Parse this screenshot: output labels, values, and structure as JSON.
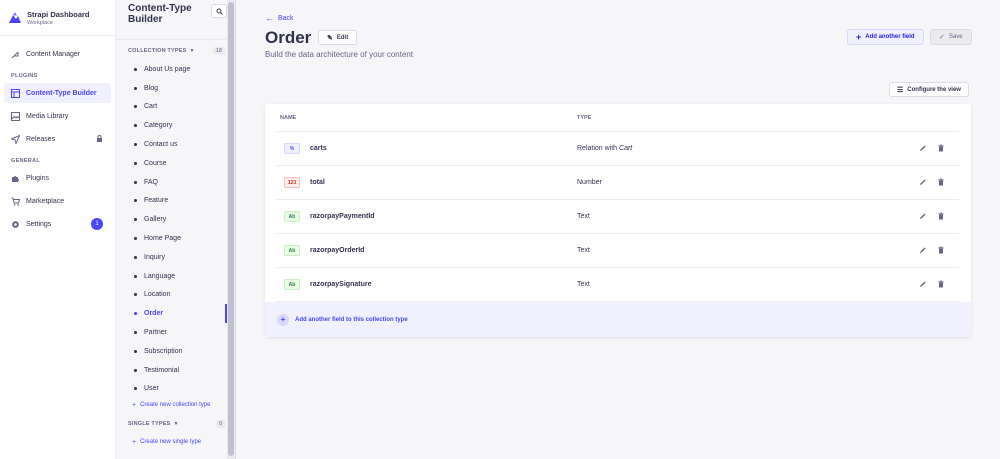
{
  "brand": {
    "name": "Strapi Dashboard",
    "sub": "Workplace"
  },
  "mainnav": {
    "content_manager": "Content Manager",
    "plugins_section": "PLUGINS",
    "ctb": "Content-Type Builder",
    "media_library": "Media Library",
    "releases": "Releases",
    "general_section": "GENERAL",
    "plugins": "Plugins",
    "marketplace": "Marketplace",
    "settings": "Settings",
    "settings_badge": "1"
  },
  "subnav": {
    "title_line1": "Content-Type",
    "title_line2": "Builder",
    "collection_label": "COLLECTION TYPES",
    "collection_count": "18",
    "collection_items": [
      "About Us page",
      "Blog",
      "Cart",
      "Category",
      "Contact us",
      "Course",
      "FAQ",
      "Feature",
      "Gallery",
      "Home Page",
      "Inquiry",
      "Language",
      "Location",
      "Order",
      "Partner",
      "Subscription",
      "Testimonial",
      "User"
    ],
    "create_collection": "Create new collection type",
    "single_label": "SINGLE TYPES",
    "single_count": "0",
    "create_single": "Create new single type"
  },
  "header": {
    "back": "Back",
    "title": "Order",
    "edit": "Edit",
    "subtitle": "Build the data architecture of your content",
    "add_field": "Add another field",
    "save": "Save",
    "configure": "Configure the view"
  },
  "table": {
    "col_name": "NAME",
    "col_type": "TYPE",
    "rows": [
      {
        "badge": "%",
        "name": "carts",
        "type_prefix": "Relation with ",
        "type_em": "Cart",
        "badge_bg": "#f0f0ff",
        "badge_fg": "#4945ff",
        "badge_border": "#d9d8ff"
      },
      {
        "badge": "123",
        "name": "total",
        "type_prefix": "Number",
        "type_em": "",
        "badge_bg": "#fcecea",
        "badge_fg": "#d02b20",
        "badge_border": "#f5c0b8"
      },
      {
        "badge": "Ab",
        "name": "razorpayPaymentId",
        "type_prefix": "Text",
        "type_em": "",
        "badge_bg": "#eafbe7",
        "badge_fg": "#328048",
        "badge_border": "#c6f0c2"
      },
      {
        "badge": "Ab",
        "name": "razorpayOrderId",
        "type_prefix": "Text",
        "type_em": "",
        "badge_bg": "#eafbe7",
        "badge_fg": "#328048",
        "badge_border": "#c6f0c2"
      },
      {
        "badge": "Ab",
        "name": "razorpaySignature",
        "type_prefix": "Text",
        "type_em": "",
        "badge_bg": "#eafbe7",
        "badge_fg": "#328048",
        "badge_border": "#c6f0c2"
      }
    ],
    "add_row": "Add another field to this collection type"
  },
  "icons": {
    "search": "search-icon",
    "pencil": "pencil-icon",
    "trash": "trash-icon",
    "plus": "plus-icon",
    "check": "check-icon",
    "lock": "lock-icon"
  },
  "colors": {
    "accent": "#4945ff",
    "active_bg": "#f0f0ff",
    "text": "#32324d",
    "muted": "#666687"
  },
  "active_collection": "Order"
}
